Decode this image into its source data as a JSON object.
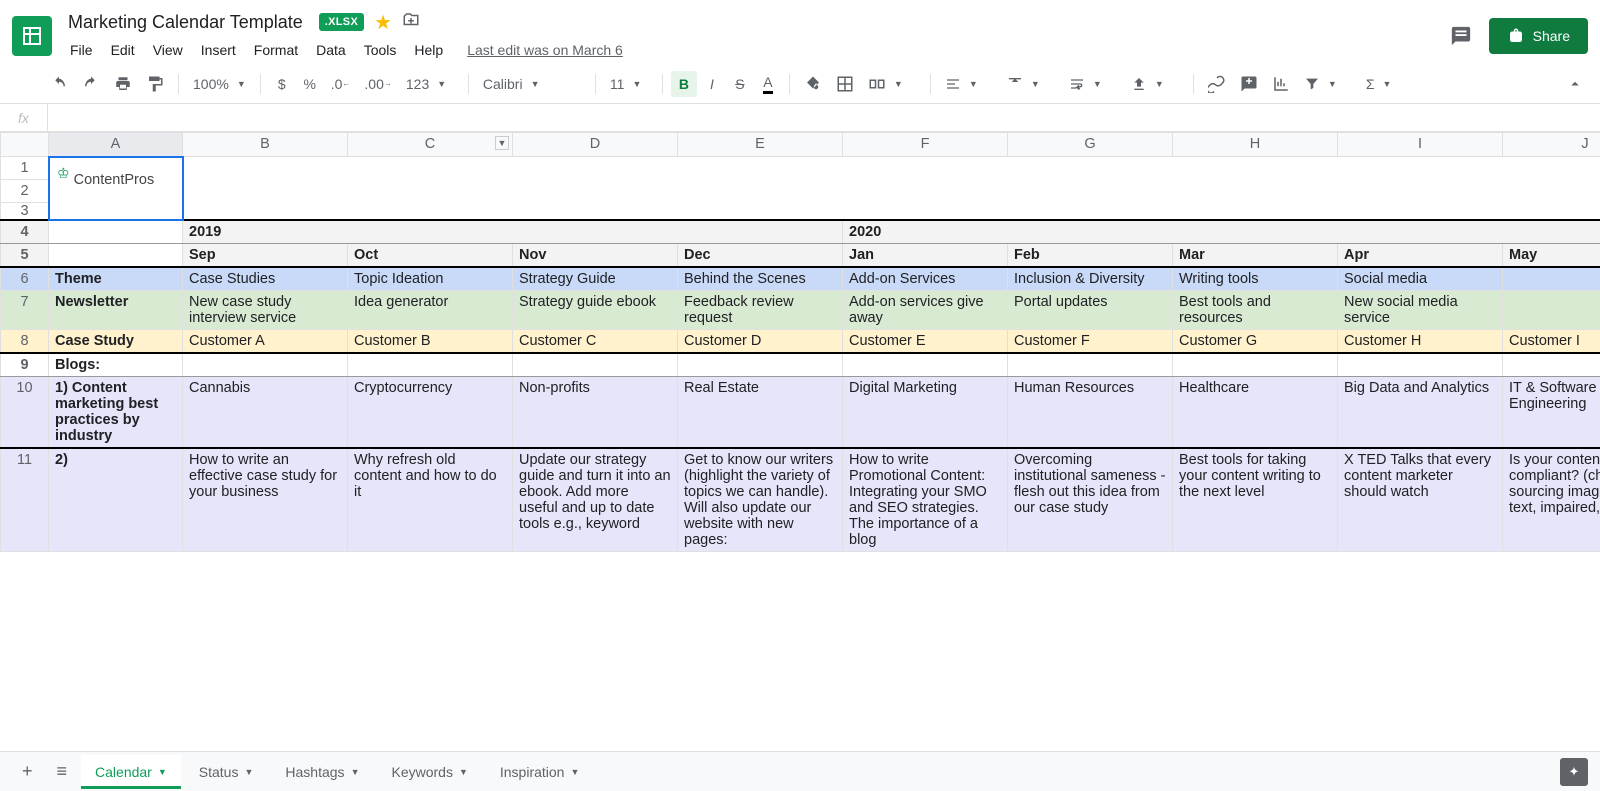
{
  "doc": {
    "title": "Marketing Calendar Template",
    "badge": ".XLSX",
    "last_edit": "Last edit was on March 6"
  },
  "menu": [
    "File",
    "Edit",
    "View",
    "Insert",
    "Format",
    "Data",
    "Tools",
    "Help"
  ],
  "toolbar": {
    "zoom": "100%",
    "font": "Calibri",
    "size": "11",
    "num_fmt": "123"
  },
  "share_label": "Share",
  "columns": [
    "A",
    "B",
    "C",
    "D",
    "E",
    "F",
    "G",
    "H",
    "I",
    "J"
  ],
  "row_numbers": [
    "1",
    "2",
    "3",
    "4",
    "5",
    "6",
    "7",
    "8",
    "9",
    "10",
    "11"
  ],
  "logo_text": "ContentPros",
  "years": {
    "y2019": "2019",
    "y2020": "2020"
  },
  "months": [
    "Sep",
    "Oct",
    "Nov",
    "Dec",
    "Jan",
    "Feb",
    "Mar",
    "Apr",
    "May"
  ],
  "rows": {
    "theme": {
      "label": "Theme",
      "cells": [
        "Case Studies",
        "Topic Ideation",
        "Strategy Guide",
        "Behind the Scenes",
        "Add-on Services",
        "Inclusion & Diversity",
        "Writing tools",
        "Social media",
        ""
      ]
    },
    "newsletter": {
      "label": "Newsletter",
      "cells": [
        "New case study interview service",
        "Idea generator",
        "Strategy guide ebook",
        "Feedback review request",
        "Add-on services give away",
        "Portal updates",
        "Best tools and resources",
        "New social media service",
        ""
      ]
    },
    "casestudy": {
      "label": "Case Study",
      "cells": [
        "Customer A",
        "Customer B",
        "Customer C",
        "Customer D",
        "Customer E",
        "Customer F",
        "Customer G",
        "Customer H",
        "Customer I"
      ]
    },
    "blogs_hdr": {
      "label": "Blogs:"
    },
    "blog1": {
      "label": "1) Content marketing best practices by industry",
      "cells": [
        "Cannabis",
        "Cryptocurrency",
        "Non-profits",
        "Real Estate",
        "Digital Marketing",
        "Human Resources",
        "Healthcare",
        "Big Data and Analytics",
        "IT & Software Engineering"
      ]
    },
    "blog2": {
      "label": "2)",
      "cells": [
        "How to write an effective case study for your business",
        "Why refresh old content and how to do it",
        "Update our strategy guide and turn it into an ebook. Add more useful and up to date tools e.g., keyword",
        "Get to know our writers (highlight the variety of topics we can handle). Will also update our website with new pages:",
        "How to write Promotional Content: Integrating your SMO and SEO strategies. The importance of a blog",
        "Overcoming institutional sameness - flesh out this idea from our case study",
        "Best tools for taking your content writing to the next level",
        "X TED Talks that every content marketer should watch",
        "Is your content compliant? (checklist: sourcing images and text, impaired, etc.)"
      ]
    }
  },
  "tabs": [
    {
      "label": "Calendar",
      "active": true
    },
    {
      "label": "Status",
      "active": false
    },
    {
      "label": "Hashtags",
      "active": false
    },
    {
      "label": "Keywords",
      "active": false
    },
    {
      "label": "Inspiration",
      "active": false
    }
  ]
}
